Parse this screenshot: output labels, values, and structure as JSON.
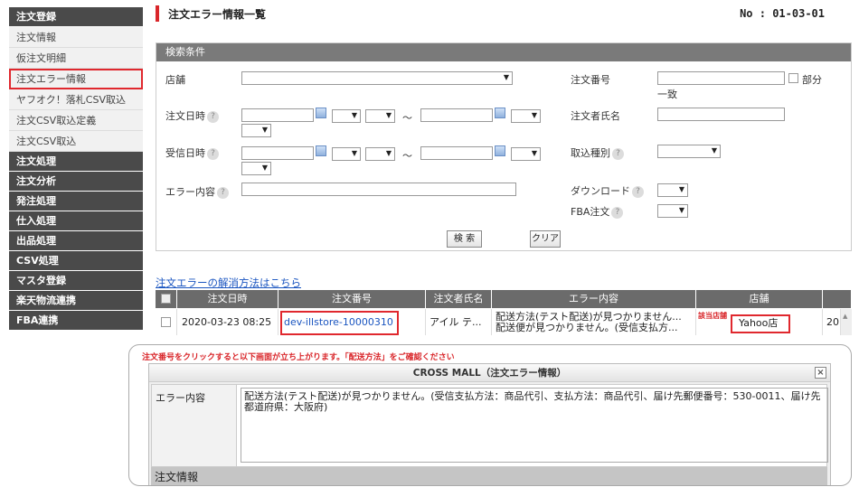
{
  "sidebar": {
    "sections": [
      {
        "head": "注文登録",
        "items": [
          "注文情報",
          "仮注文明細",
          "注文エラー情報",
          "ヤフオク！落札CSV取込",
          "注文CSV取込定義",
          "注文CSV取込"
        ]
      },
      {
        "head": "注文処理"
      },
      {
        "head": "注文分析"
      },
      {
        "head": "発注処理"
      },
      {
        "head": "仕入処理"
      },
      {
        "head": "出品処理"
      },
      {
        "head": "CSV処理"
      },
      {
        "head": "マスタ登録"
      },
      {
        "head": "楽天物流連携"
      },
      {
        "head": "FBA連携"
      }
    ],
    "selected": "注文エラー情報"
  },
  "page": {
    "title": "注文エラー情報一覧",
    "number": "No : 01-03-01"
  },
  "search": {
    "header": "検索条件",
    "store_label": "店舗",
    "order_no_label": "注文番号",
    "partial_label": "部分",
    "exact_label": "一致",
    "order_date_label": "注文日時",
    "orderer_label": "注文者氏名",
    "received_label": "受信日時",
    "import_type_label": "取込種別",
    "error_label": "エラー内容",
    "download_label": "ダウンロード",
    "fba_label": "FBA注文",
    "tilde": "～",
    "search_btn": "検 索",
    "clear_btn": "クリア"
  },
  "help_link": "注文エラーの解消方法はこちら",
  "table": {
    "headers": [
      "注文日時",
      "注文番号",
      "注文者氏名",
      "エラー内容",
      "店舗"
    ],
    "row": {
      "date": "2020-03-23 08:25",
      "order_no": "dev-illstore-10000310",
      "orderer": "アイル テ...",
      "error_line1": "配送方法(テスト配送)が見つかりません...",
      "error_line2": "配送便が見つかりません。(受信支払方...",
      "store": "Yahoo店",
      "extra": "20"
    },
    "store_note": "該当店舗"
  },
  "popup": {
    "note": "注文番号をクリックすると以下画面が立ち上がります。「配送方法」をご確認ください",
    "title": "CROSS MALL（注文エラー情報）",
    "close": "×",
    "error_label": "エラー内容",
    "error_text": "配送方法(テスト配送)が見つかりません。(受信支払方法：商品代引、支払方法：商品代引、届け先郵便番号：530-0011、届け先都道府県：大阪府)",
    "order_section": "注文情報"
  }
}
